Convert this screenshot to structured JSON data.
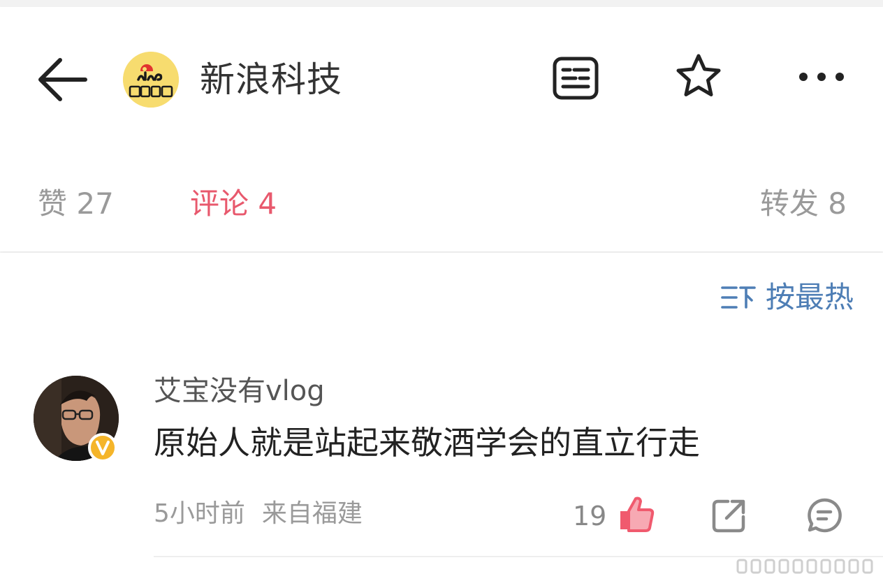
{
  "header": {
    "title": "新浪科技",
    "back_icon": "arrow-left-icon",
    "brand_logo_text": "sina 新浪科技",
    "actions": [
      "reader-mode-icon",
      "star-icon",
      "more-icon"
    ]
  },
  "stats": {
    "like_label": "赞 27",
    "comment_label": "评论 4",
    "repost_label": "转发 8",
    "active_color": "#e8596d",
    "inactive_color": "#9a9a9a"
  },
  "sort": {
    "icon": "sort-icon",
    "label": "按最热",
    "color": "#4e7eb5"
  },
  "comments": [
    {
      "username": "艾宝没有vlog",
      "verified": true,
      "text": "原始人就是站起来敬酒学会的直立行走",
      "time": "5小时前",
      "location": "来自福建",
      "likes": "19",
      "like_color": "#f05a6e"
    }
  ]
}
